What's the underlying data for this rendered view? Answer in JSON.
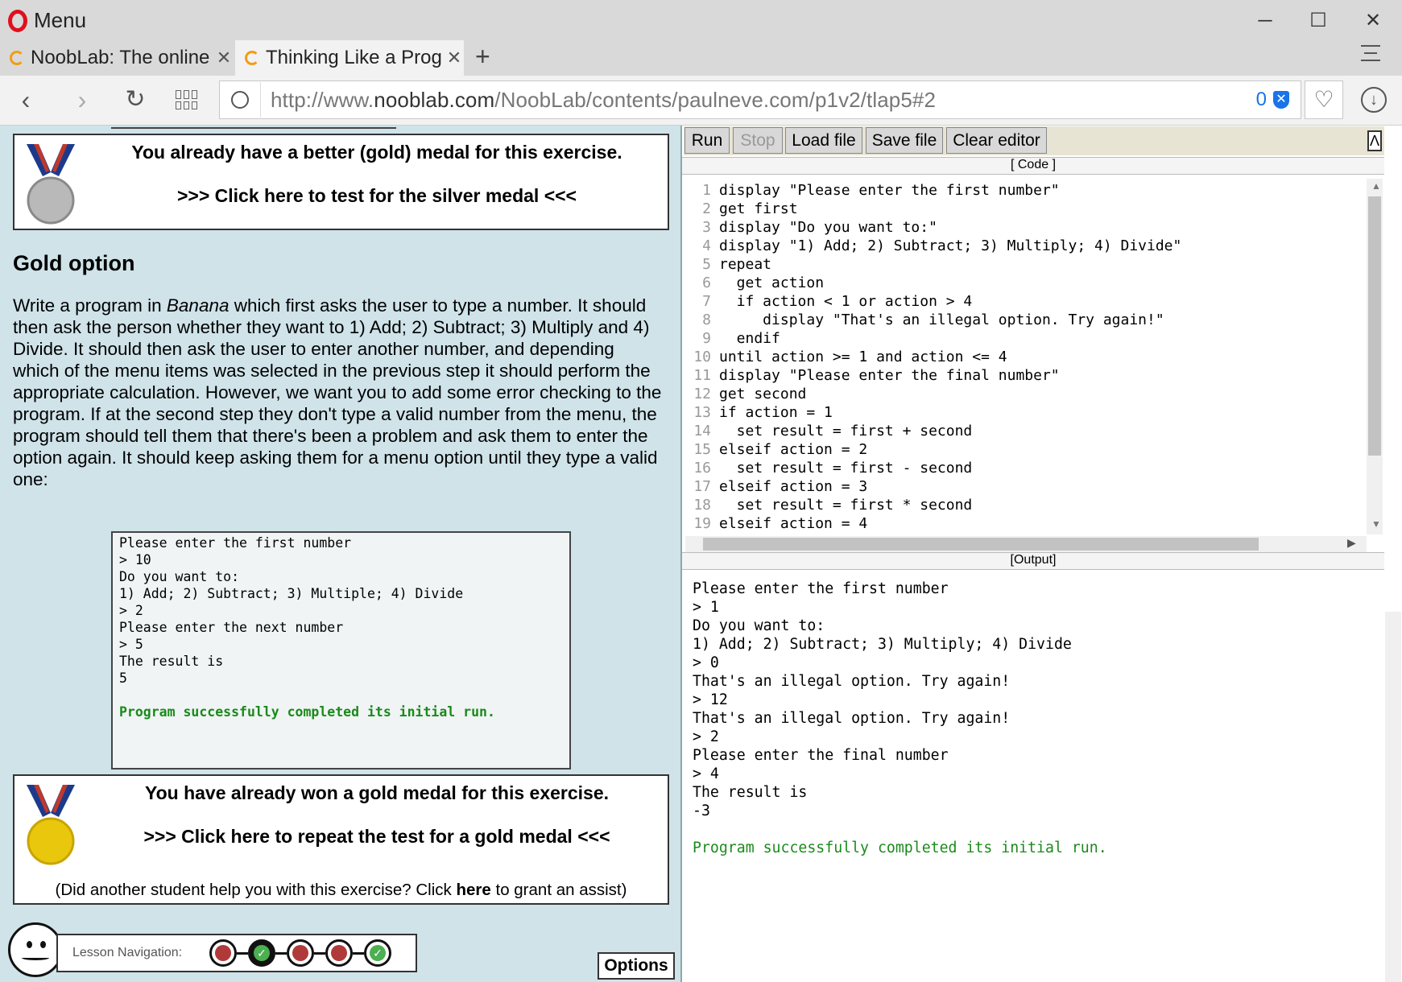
{
  "window": {
    "menu_label": "Menu",
    "minimize": "─",
    "maximize": "☐",
    "close": "✕"
  },
  "tabs": [
    {
      "title": "NoobLab: The online",
      "close": "✕"
    },
    {
      "title": "Thinking Like a Prog",
      "close": "✕"
    }
  ],
  "new_tab": "+",
  "address": {
    "url_prefix": "http://www.",
    "url_host": "nooblab.com",
    "url_path": "/NoobLab/contents/paulneve.com/p1v2/tlap5#2",
    "badge_count": "0"
  },
  "silver_box": {
    "line1": "You already have a better (gold) medal for this exercise.",
    "line2": ">>> Click here to test for the silver medal <<<"
  },
  "gold_heading": "Gold option",
  "task": {
    "before_italic": "Write a program in ",
    "italic": "Banana",
    "after_italic": " which first asks the user to type a number. It should then ask the person whether they want to 1) Add; 2) Subtract; 3) Multiply and 4) Divide. It should then ask the user to enter another number, and depending which of the menu items was selected in the previous step it should perform the appropriate calculation. However, we want you to add some error checking to the program. If at the second step they don't type a valid number from the menu, the program should tell them that there's been a problem and ask them to enter the option again. It should keep asking them for a menu option until they type a valid one:"
  },
  "sample_output": {
    "lines": [
      "Please enter the first number",
      "> 10",
      "Do you want to:",
      "1) Add; 2) Subtract; 3) Multiple; 4) Divide",
      "> 2",
      "Please enter the next number",
      "> 5",
      "The result is",
      "5",
      ""
    ],
    "success": "Program successfully completed its initial run."
  },
  "gold_box": {
    "line1": "You have already won a gold medal for this exercise.",
    "line2": ">>> Click here to repeat the test for a gold medal <<<",
    "assist_before": "(Did another student help you with this exercise? Click ",
    "assist_link": "here",
    "assist_after": " to grant an assist)"
  },
  "lesson_nav": {
    "label": "Lesson Navigation:",
    "dots": [
      {
        "state": "incomplete",
        "color": "#b03a3a"
      },
      {
        "state": "current-complete",
        "color": "#111111"
      },
      {
        "state": "incomplete",
        "color": "#b03a3a"
      },
      {
        "state": "incomplete",
        "color": "#b03a3a"
      },
      {
        "state": "complete",
        "color": "#4caf50"
      }
    ]
  },
  "options_label": "Options",
  "toolbar": {
    "run": "Run",
    "stop": "Stop",
    "load": "Load file",
    "save": "Save file",
    "clear": "Clear editor",
    "collapse": "Λ"
  },
  "code_label": "[ Code ]",
  "output_label": "[Output]",
  "code_lines": [
    "display \"Please enter the first number\"",
    "get first",
    "display \"Do you want to:\"",
    "display \"1) Add; 2) Subtract; 3) Multiply; 4) Divide\"",
    "repeat",
    "  get action",
    "  if action < 1 or action > 4",
    "     display \"That's an illegal option. Try again!\"",
    "  endif",
    "until action >= 1 and action <= 4",
    "display \"Please enter the final number\"",
    "get second",
    "if action = 1",
    "  set result = first + second",
    "elseif action = 2",
    "  set result = first - second",
    "elseif action = 3",
    "  set result = first * second",
    "elseif action = 4"
  ],
  "output_lines": [
    "Please enter the first number",
    "> 1",
    "Do you want to:",
    "1) Add; 2) Subtract; 3) Multiply; 4) Divide",
    "> 0",
    "That's an illegal option. Try again!",
    "> 12",
    "That's an illegal option. Try again!",
    "> 2",
    "Please enter the final number",
    "> 4",
    "The result is",
    "-3",
    ""
  ],
  "output_success": "Program successfully completed its initial run."
}
